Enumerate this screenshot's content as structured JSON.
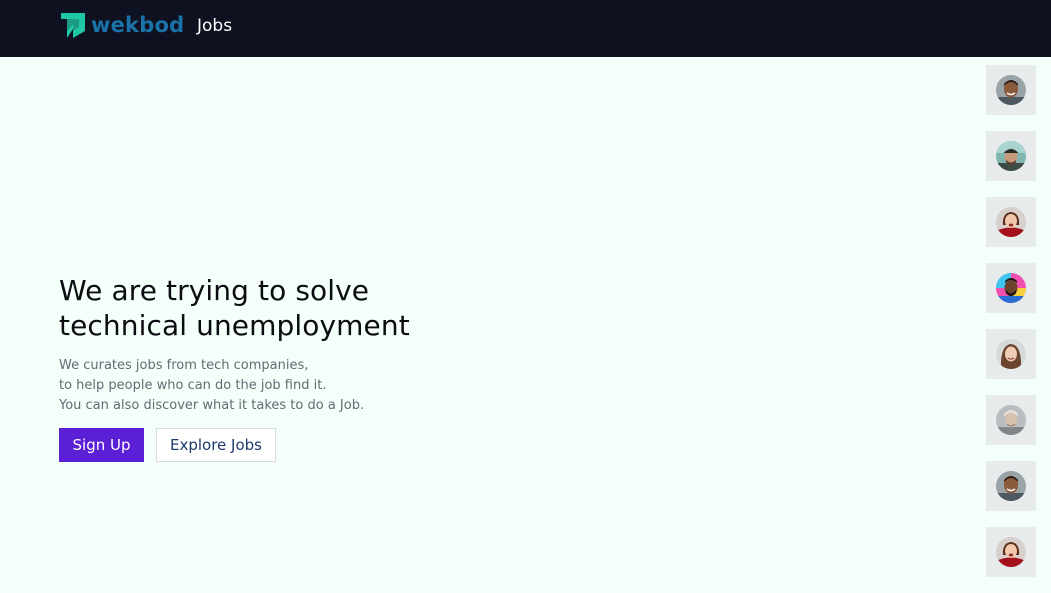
{
  "header": {
    "brand": "wekbod",
    "nav_jobs": "Jobs"
  },
  "hero": {
    "title_line1": "We are trying to solve",
    "title_line2": "technical unemployment",
    "desc_line1": "We curates jobs from tech companies,",
    "desc_line2": "to help people who can do the job find it.",
    "desc_line3": "You can also discover what it takes to do a Job.",
    "signup_label": "Sign Up",
    "explore_label": "Explore Jobs"
  },
  "colors": {
    "nav_bg": "#0e1120",
    "page_bg": "#f5fffa",
    "brand_text": "#1a73a8",
    "logo_mark": "#1fc7a4",
    "primary_button": "#5b1fd6"
  },
  "avatars": [
    {
      "icon": "avatar-man-smiling-icon"
    },
    {
      "icon": "avatar-man-cap-outdoor-icon"
    },
    {
      "icon": "avatar-woman-red-top-icon"
    },
    {
      "icon": "avatar-man-colorful-bg-icon"
    },
    {
      "icon": "avatar-woman-brown-hair-icon"
    },
    {
      "icon": "avatar-person-grey-icon"
    },
    {
      "icon": "avatar-man-smiling-icon"
    },
    {
      "icon": "avatar-woman-red-top-icon"
    }
  ]
}
